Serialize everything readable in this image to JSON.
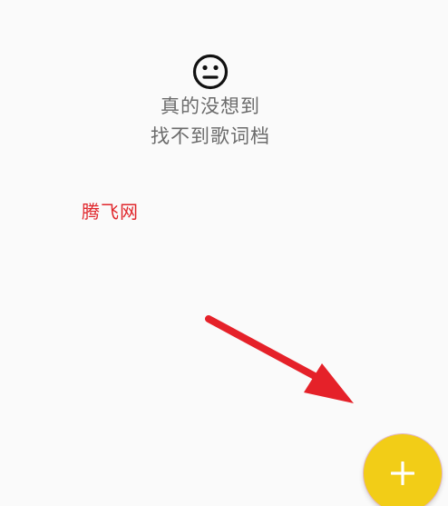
{
  "empty_state": {
    "icon": "neutral-face-icon",
    "line1": "真的没想到",
    "line2": "找不到歌词档"
  },
  "watermark": {
    "text": "腾飞网"
  },
  "annotation": {
    "icon": "arrow-icon",
    "color": "#e52129"
  },
  "fab": {
    "icon": "plus-icon",
    "background": "#f2cd17"
  }
}
